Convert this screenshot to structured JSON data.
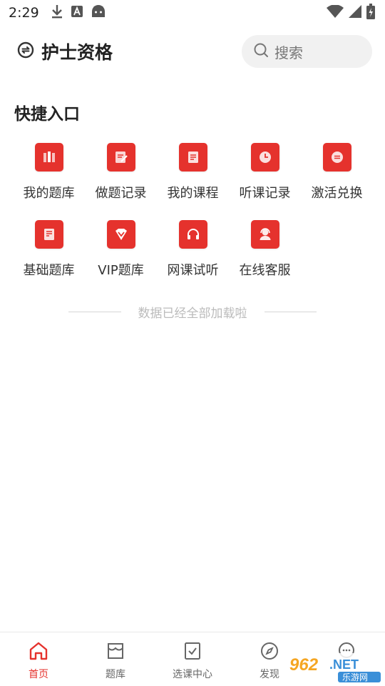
{
  "status_bar": {
    "time": "2:29",
    "left_icons": [
      "download-icon",
      "font-a-icon",
      "android-icon"
    ],
    "right_icons": [
      "wifi-icon",
      "signal-icon",
      "battery-icon"
    ]
  },
  "header": {
    "title": "护士资格",
    "search_placeholder": "搜索"
  },
  "shortcuts": {
    "title": "快捷入口",
    "items": [
      {
        "label": "我的题库",
        "icon": "question-bank-icon"
      },
      {
        "label": "做题记录",
        "icon": "practice-record-icon"
      },
      {
        "label": "我的课程",
        "icon": "course-icon"
      },
      {
        "label": "听课记录",
        "icon": "listen-record-icon"
      },
      {
        "label": "激活兑换",
        "icon": "exchange-icon"
      },
      {
        "label": "基础题库",
        "icon": "basic-bank-icon"
      },
      {
        "label": "VIP题库",
        "icon": "vip-icon"
      },
      {
        "label": "网课试听",
        "icon": "headphones-icon"
      },
      {
        "label": "在线客服",
        "icon": "customer-service-icon"
      }
    ]
  },
  "end_text": "数据已经全部加载啦",
  "tabbar": {
    "tabs": [
      {
        "label": "首页",
        "icon": "home-icon",
        "active": true
      },
      {
        "label": "题库",
        "icon": "question-bank-tab-icon",
        "active": false
      },
      {
        "label": "选课中心",
        "icon": "course-select-icon",
        "active": false
      },
      {
        "label": "发现",
        "icon": "compass-icon",
        "active": false
      },
      {
        "label": "",
        "icon": "chat-icon",
        "active": false
      }
    ]
  },
  "watermark": {
    "text": "962.NET",
    "subtext": "乐游网"
  },
  "colors": {
    "accent": "#e5322d",
    "tile": "#e5322d",
    "search_bg": "#f1f1f1"
  }
}
